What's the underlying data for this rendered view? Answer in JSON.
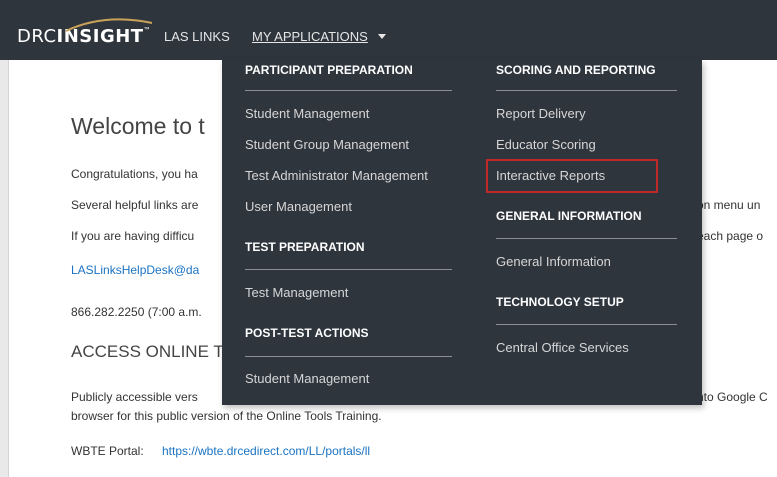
{
  "nav": {
    "logo_drc": "DRC",
    "logo_insight": "INSIGHT",
    "logo_tm": "™",
    "las_links": "LAS LINKS",
    "my_applications": "MY APPLICATIONS"
  },
  "page": {
    "welcome": "Welcome to t",
    "congrats": "Congratulations, you ha",
    "several": "Several helpful links are",
    "several_tail": "on menu un",
    "difficulty": "If you are having difficu",
    "difficulty_tail": "each page o",
    "email": "LASLinksHelpDesk@da",
    "phone": "866.282.2250 (7:00 a.m.",
    "access": "ACCESS ONLINE T",
    "public1": "Publicly accessible vers",
    "public1_tail": "nto Google C",
    "public2": "browser for this public version of the Online Tools Training.",
    "wbte_label": "WBTE Portal:",
    "wbte_url": "https://wbte.drcedirect.com/LL/portals/ll"
  },
  "menu": {
    "col1": {
      "participant_header": "PARTICIPANT PREPARATION",
      "participant_items": [
        "Student Management",
        "Student Group Management",
        "Test Administrator Management",
        "User Management"
      ],
      "test_prep_header": "TEST PREPARATION",
      "test_prep_items": [
        "Test Management"
      ],
      "post_test_header": "POST-TEST ACTIONS",
      "post_test_items": [
        "Student Management"
      ]
    },
    "col2": {
      "scoring_header": "SCORING AND REPORTING",
      "scoring_items": [
        "Report Delivery",
        "Educator Scoring",
        "Interactive Reports"
      ],
      "general_header": "GENERAL INFORMATION",
      "general_items": [
        "General Information"
      ],
      "tech_header": "TECHNOLOGY SETUP",
      "tech_items": [
        "Central Office Services"
      ]
    }
  },
  "colors": {
    "topbar": "#2f353d",
    "link": "#1a73c2",
    "highlight": "#c0282a"
  }
}
